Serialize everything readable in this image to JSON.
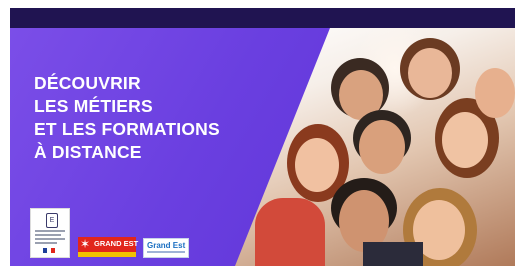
{
  "banner": {
    "title_lines": [
      "DÉCOUVRIR",
      "LES MÉTIERS",
      "ET LES FORMATIONS",
      "À DISTANCE"
    ],
    "logos": {
      "left": "quality-label-logo",
      "middle_text": "GRAND EST",
      "right_text": "Grand Est"
    }
  },
  "colors": {
    "panel_purple": "#6a3fe0",
    "top_bar": "#201451",
    "title_text": "#ffffff",
    "grand_est_red": "#e1261c",
    "grand_est_blue": "#1b6fc2"
  }
}
